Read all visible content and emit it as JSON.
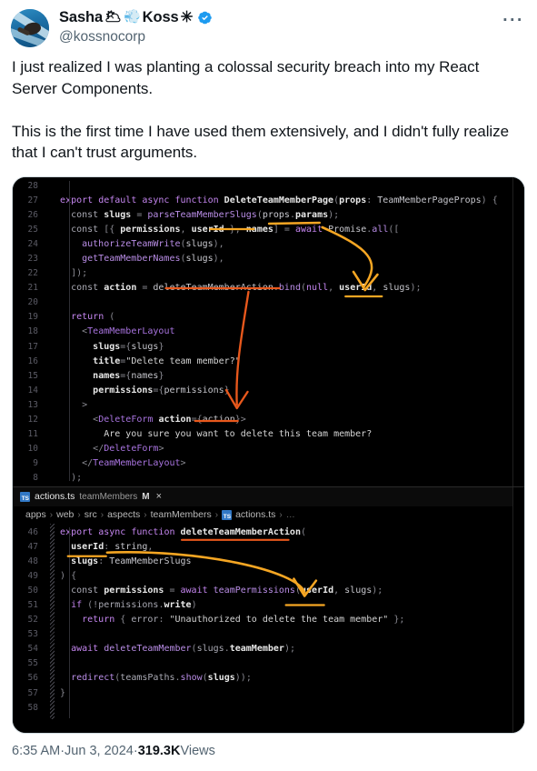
{
  "post": {
    "author": {
      "display_name": "Sasha",
      "name_emoji_1": "🌥",
      "name_emoji_2": "💨",
      "display_name_2": "Koss",
      "name_symbol": "✳",
      "verified_badge": "verified-check",
      "handle": "@kossnocorp",
      "avatar_alt": "swimmer-in-blue-water"
    },
    "more_menu_label": "···",
    "text": "I just realized I was planting a colossal security breach into my React Server Components.\n\nThis is the first time I have used them extensively, and I didn't fully realize that I can't trust arguments.",
    "footer": {
      "time": "6:35 AM",
      "sep1": " · ",
      "date": "Jun 3, 2024",
      "sep2": " · ",
      "views_count": "319.3K",
      "views_label": " Views"
    }
  },
  "media": {
    "top_pane": {
      "lines": [
        {
          "num": "28",
          "segments": []
        },
        {
          "num": "27",
          "segments": [
            {
              "t": "  ",
              "c": "pl"
            },
            {
              "t": "export default async ",
              "c": "kw"
            },
            {
              "t": "function ",
              "c": "kw"
            },
            {
              "t": "DeleteTeamMemberPage",
              "c": "fn"
            },
            {
              "t": "(",
              "c": "punc"
            },
            {
              "t": "props",
              "c": "var"
            },
            {
              "t": ": ",
              "c": "punc"
            },
            {
              "t": "TeamMemberPageProps",
              "c": "ty"
            },
            {
              "t": ") {",
              "c": "punc"
            }
          ]
        },
        {
          "num": "26",
          "segments": [
            {
              "t": "    ",
              "c": "pl"
            },
            {
              "t": "const ",
              "c": "pl"
            },
            {
              "t": "slugs",
              "c": "var"
            },
            {
              "t": " = ",
              "c": "punc"
            },
            {
              "t": "parseTeamMemberSlugs",
              "c": "fn2"
            },
            {
              "t": "(",
              "c": "punc"
            },
            {
              "t": "props",
              "c": "prop"
            },
            {
              "t": ".",
              "c": "punc"
            },
            {
              "t": "params",
              "c": "var"
            },
            {
              "t": ");",
              "c": "punc"
            }
          ]
        },
        {
          "num": "25",
          "segments": [
            {
              "t": "    ",
              "c": "pl"
            },
            {
              "t": "const ",
              "c": "pl"
            },
            {
              "t": "[{ ",
              "c": "punc"
            },
            {
              "t": "permissions",
              "c": "var"
            },
            {
              "t": ", ",
              "c": "punc"
            },
            {
              "t": "userId",
              "c": "var"
            },
            {
              "t": " }, ",
              "c": "punc"
            },
            {
              "t": "names",
              "c": "var"
            },
            {
              "t": "] = ",
              "c": "punc"
            },
            {
              "t": "await ",
              "c": "kw"
            },
            {
              "t": "Promise",
              "c": "ty"
            },
            {
              "t": ".",
              "c": "punc"
            },
            {
              "t": "all",
              "c": "fn2"
            },
            {
              "t": "([",
              "c": "punc"
            }
          ]
        },
        {
          "num": "24",
          "segments": [
            {
              "t": "      ",
              "c": "pl"
            },
            {
              "t": "authorizeTeamWrite",
              "c": "fn2"
            },
            {
              "t": "(",
              "c": "punc"
            },
            {
              "t": "slugs",
              "c": "ty"
            },
            {
              "t": "),",
              "c": "punc"
            }
          ]
        },
        {
          "num": "23",
          "segments": [
            {
              "t": "      ",
              "c": "pl"
            },
            {
              "t": "getTeamMemberNames",
              "c": "fn2"
            },
            {
              "t": "(",
              "c": "punc"
            },
            {
              "t": "slugs",
              "c": "ty"
            },
            {
              "t": "),",
              "c": "punc"
            }
          ]
        },
        {
          "num": "22",
          "segments": [
            {
              "t": "    ]);",
              "c": "punc"
            }
          ]
        },
        {
          "num": "21",
          "segments": [
            {
              "t": "    ",
              "c": "pl"
            },
            {
              "t": "const ",
              "c": "pl"
            },
            {
              "t": "action",
              "c": "var"
            },
            {
              "t": " = ",
              "c": "punc"
            },
            {
              "t": "deleteTeamMemberAction",
              "c": "ty"
            },
            {
              "t": ".",
              "c": "punc"
            },
            {
              "t": "bind",
              "c": "fn2"
            },
            {
              "t": "(",
              "c": "punc"
            },
            {
              "t": "null",
              "c": "kw"
            },
            {
              "t": ", ",
              "c": "punc"
            },
            {
              "t": "userId",
              "c": "var"
            },
            {
              "t": ", ",
              "c": "punc"
            },
            {
              "t": "slugs",
              "c": "ty"
            },
            {
              "t": ");",
              "c": "punc"
            }
          ]
        },
        {
          "num": "20",
          "segments": []
        },
        {
          "num": "19",
          "segments": [
            {
              "t": "    ",
              "c": "pl"
            },
            {
              "t": "return ",
              "c": "kw"
            },
            {
              "t": "(",
              "c": "punc"
            }
          ]
        },
        {
          "num": "18",
          "segments": [
            {
              "t": "      ",
              "c": "pl"
            },
            {
              "t": "<",
              "c": "punc"
            },
            {
              "t": "TeamMemberLayout",
              "c": "tag"
            }
          ]
        },
        {
          "num": "17",
          "segments": [
            {
              "t": "        ",
              "c": "pl"
            },
            {
              "t": "slugs",
              "c": "var"
            },
            {
              "t": "={",
              "c": "punc"
            },
            {
              "t": "slugs",
              "c": "ty"
            },
            {
              "t": "}",
              "c": "punc"
            }
          ]
        },
        {
          "num": "16",
          "segments": [
            {
              "t": "        ",
              "c": "pl"
            },
            {
              "t": "title",
              "c": "var"
            },
            {
              "t": "=",
              "c": "punc"
            },
            {
              "t": "\"Delete team member?\"",
              "c": "str"
            }
          ]
        },
        {
          "num": "15",
          "segments": [
            {
              "t": "        ",
              "c": "pl"
            },
            {
              "t": "names",
              "c": "var"
            },
            {
              "t": "={",
              "c": "punc"
            },
            {
              "t": "names",
              "c": "ty"
            },
            {
              "t": "}",
              "c": "punc"
            }
          ]
        },
        {
          "num": "14",
          "segments": [
            {
              "t": "        ",
              "c": "pl"
            },
            {
              "t": "permissions",
              "c": "var"
            },
            {
              "t": "={",
              "c": "punc"
            },
            {
              "t": "permissions",
              "c": "ty"
            },
            {
              "t": "}",
              "c": "punc"
            }
          ]
        },
        {
          "num": "13",
          "segments": [
            {
              "t": "      >",
              "c": "punc"
            }
          ]
        },
        {
          "num": "12",
          "segments": [
            {
              "t": "        ",
              "c": "pl"
            },
            {
              "t": "<",
              "c": "punc"
            },
            {
              "t": "DeleteForm",
              "c": "tag"
            },
            {
              "t": " ",
              "c": "pl"
            },
            {
              "t": "action",
              "c": "var"
            },
            {
              "t": "={",
              "c": "punc"
            },
            {
              "t": "action",
              "c": "ty"
            },
            {
              "t": "}>",
              "c": "punc"
            }
          ]
        },
        {
          "num": "11",
          "segments": [
            {
              "t": "          Are you sure you want to delete this team member?",
              "c": "txt"
            }
          ]
        },
        {
          "num": "10",
          "segments": [
            {
              "t": "        ",
              "c": "pl"
            },
            {
              "t": "</",
              "c": "punc"
            },
            {
              "t": "DeleteForm",
              "c": "tag"
            },
            {
              "t": ">",
              "c": "punc"
            }
          ]
        },
        {
          "num": "9",
          "segments": [
            {
              "t": "      ",
              "c": "pl"
            },
            {
              "t": "</",
              "c": "punc"
            },
            {
              "t": "TeamMemberLayout",
              "c": "tag"
            },
            {
              "t": ">",
              "c": "punc"
            }
          ]
        },
        {
          "num": "8",
          "segments": [
            {
              "t": "    );",
              "c": "punc"
            }
          ]
        }
      ]
    },
    "bottom_pane": {
      "tab": {
        "icon": "typescript-file-icon",
        "icon_label": "TS",
        "filename": "actions.ts",
        "folder": "teamMembers",
        "modified_flag": "M",
        "close_label": "×"
      },
      "breadcrumb": {
        "parts": [
          "apps",
          "web",
          "src",
          "aspects",
          "teamMembers"
        ],
        "file_icon_label": "TS",
        "file": "actions.ts",
        "tail": "…",
        "separator": "›"
      },
      "lines": [
        {
          "num": "46",
          "segments": [
            {
              "t": "  ",
              "c": "pl"
            },
            {
              "t": "export async ",
              "c": "kw"
            },
            {
              "t": "function ",
              "c": "kw"
            },
            {
              "t": "deleteTeamMemberAction",
              "c": "fn"
            },
            {
              "t": "(",
              "c": "punc"
            }
          ]
        },
        {
          "num": "47",
          "segments": [
            {
              "t": "    ",
              "c": "pl"
            },
            {
              "t": "userId",
              "c": "var"
            },
            {
              "t": ": ",
              "c": "punc"
            },
            {
              "t": "string",
              "c": "ty"
            },
            {
              "t": ",",
              "c": "punc"
            }
          ]
        },
        {
          "num": "48",
          "segments": [
            {
              "t": "    ",
              "c": "pl"
            },
            {
              "t": "slugs",
              "c": "var"
            },
            {
              "t": ": ",
              "c": "punc"
            },
            {
              "t": "TeamMemberSlugs",
              "c": "ty"
            }
          ]
        },
        {
          "num": "49",
          "segments": [
            {
              "t": "  ) {",
              "c": "punc"
            }
          ]
        },
        {
          "num": "50",
          "segments": [
            {
              "t": "    ",
              "c": "pl"
            },
            {
              "t": "const ",
              "c": "pl"
            },
            {
              "t": "permissions",
              "c": "var"
            },
            {
              "t": " = ",
              "c": "punc"
            },
            {
              "t": "await ",
              "c": "kw"
            },
            {
              "t": "teamPermissions",
              "c": "fn2"
            },
            {
              "t": "(",
              "c": "punc"
            },
            {
              "t": "userId",
              "c": "var"
            },
            {
              "t": ", ",
              "c": "punc"
            },
            {
              "t": "slugs",
              "c": "ty"
            },
            {
              "t": ");",
              "c": "punc"
            }
          ]
        },
        {
          "num": "51",
          "segments": [
            {
              "t": "    ",
              "c": "pl"
            },
            {
              "t": "if ",
              "c": "kw"
            },
            {
              "t": "(!",
              "c": "punc"
            },
            {
              "t": "permissions",
              "c": "pl"
            },
            {
              "t": ".",
              "c": "punc"
            },
            {
              "t": "write",
              "c": "var"
            },
            {
              "t": ")",
              "c": "punc"
            }
          ]
        },
        {
          "num": "52",
          "segments": [
            {
              "t": "      ",
              "c": "pl"
            },
            {
              "t": "return ",
              "c": "kw"
            },
            {
              "t": "{ ",
              "c": "punc"
            },
            {
              "t": "error",
              "c": "pl"
            },
            {
              "t": ": ",
              "c": "punc"
            },
            {
              "t": "\"Unauthorized to delete the team member\"",
              "c": "str"
            },
            {
              "t": " };",
              "c": "punc"
            }
          ]
        },
        {
          "num": "53",
          "segments": []
        },
        {
          "num": "54",
          "segments": [
            {
              "t": "    ",
              "c": "pl"
            },
            {
              "t": "await ",
              "c": "kw"
            },
            {
              "t": "deleteTeamMember",
              "c": "fn2"
            },
            {
              "t": "(",
              "c": "punc"
            },
            {
              "t": "slugs",
              "c": "pl"
            },
            {
              "t": ".",
              "c": "punc"
            },
            {
              "t": "teamMember",
              "c": "var"
            },
            {
              "t": ");",
              "c": "punc"
            }
          ]
        },
        {
          "num": "55",
          "segments": []
        },
        {
          "num": "56",
          "segments": [
            {
              "t": "    ",
              "c": "pl"
            },
            {
              "t": "redirect",
              "c": "fn2"
            },
            {
              "t": "(",
              "c": "punc"
            },
            {
              "t": "teamsPaths",
              "c": "pl"
            },
            {
              "t": ".",
              "c": "punc"
            },
            {
              "t": "show",
              "c": "fn2"
            },
            {
              "t": "(",
              "c": "punc"
            },
            {
              "t": "slugs",
              "c": "var"
            },
            {
              "t": "));",
              "c": "punc"
            }
          ]
        },
        {
          "num": "57",
          "segments": [
            {
              "t": "  }",
              "c": "punc"
            }
          ]
        },
        {
          "num": "58",
          "segments": []
        }
      ]
    },
    "annotation_colors": {
      "amber": "#f5a623",
      "orange_red": "#e8581c"
    }
  }
}
